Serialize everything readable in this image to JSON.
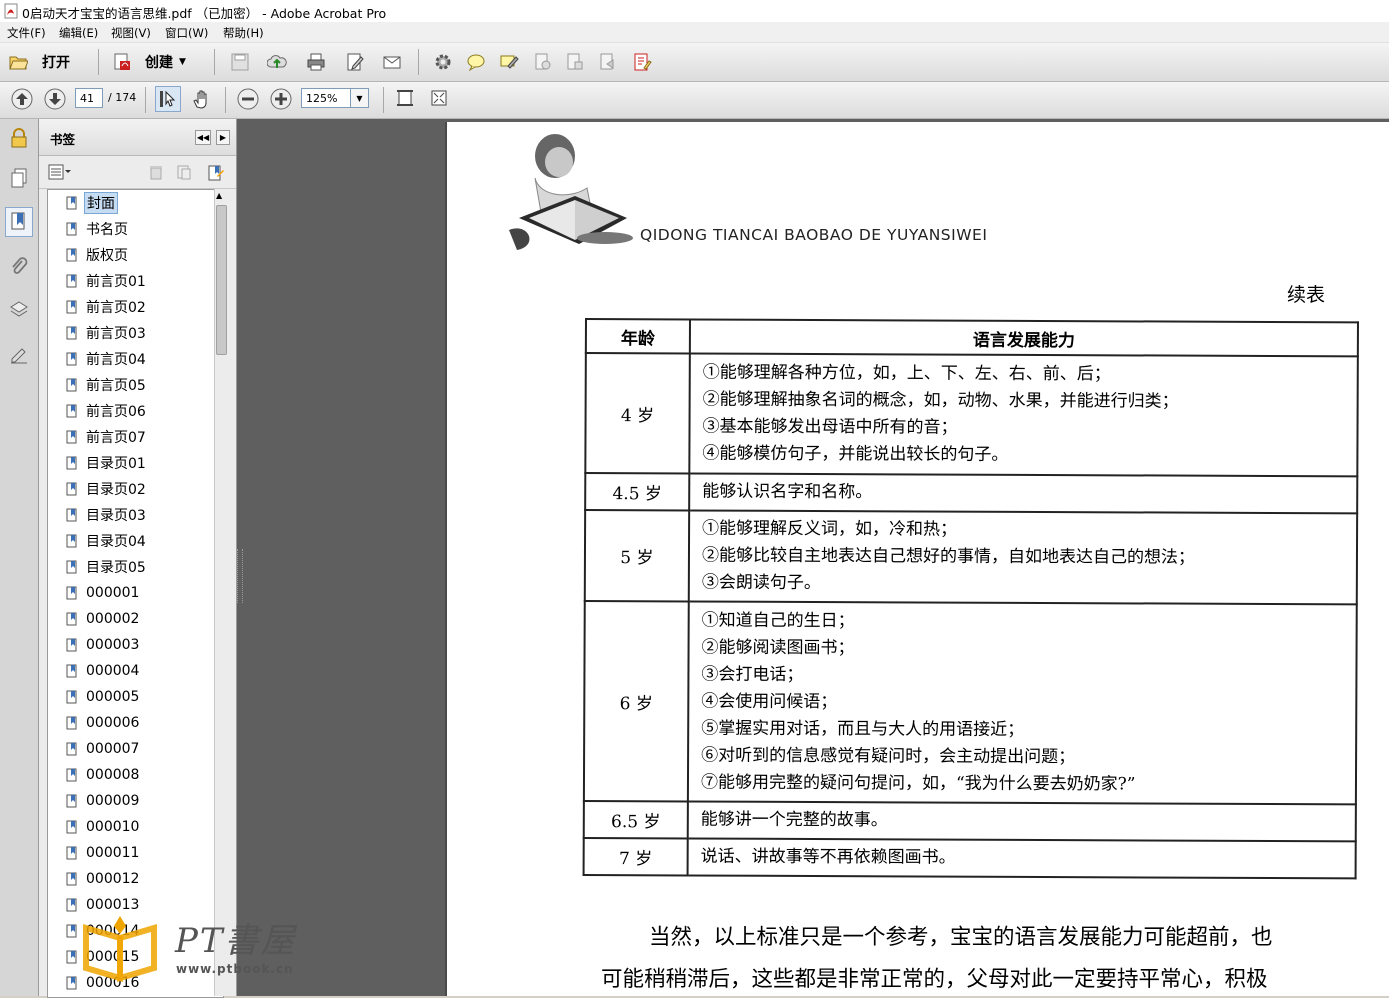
{
  "window": {
    "title": "0启动天才宝宝的语言思维.pdf （已加密） - Adobe Acrobat Pro"
  },
  "menu": [
    "文件(F)",
    "编辑(E)",
    "视图(V)",
    "窗口(W)",
    "帮助(H)"
  ],
  "toolbar": {
    "open_label": "打开",
    "create_label": "创建"
  },
  "nav": {
    "page_number": "41",
    "page_total": "/ 174",
    "zoom": "125%"
  },
  "bookmarks": {
    "title": "书签",
    "items": [
      "封面",
      "书名页",
      "版权页",
      "前言页01",
      "前言页02",
      "前言页03",
      "前言页04",
      "前言页05",
      "前言页06",
      "前言页07",
      "目录页01",
      "目录页02",
      "目录页03",
      "目录页04",
      "目录页05",
      "000001",
      "000002",
      "000003",
      "000004",
      "000005",
      "000006",
      "000007",
      "000008",
      "000009",
      "000010",
      "000011",
      "000012",
      "000013",
      "000014",
      "000015",
      "000016"
    ],
    "selected": "封面"
  },
  "document": {
    "header_text": "QIDONG TIANCAI BAOBAO DE YUYANSIWEI",
    "continued": "续表",
    "table": {
      "headers": [
        "年龄",
        "语言发展能力"
      ],
      "rows": [
        {
          "age": "4 岁",
          "lines": [
            "①能够理解各种方位，如，上、下、左、右、前、后；",
            "②能够理解抽象名词的概念，如，动物、水果，并能进行归类；",
            "③基本能够发出母语中所有的音；",
            "④能够模仿句子，并能说出较长的句子。"
          ]
        },
        {
          "age": "4.5 岁",
          "lines": [
            "能够认识名字和名称。"
          ]
        },
        {
          "age": "5 岁",
          "lines": [
            "①能够理解反义词，如，冷和热；",
            "②能够比较自主地表达自己想好的事情，自如地表达自己的想法；",
            "③会朗读句子。"
          ]
        },
        {
          "age": "6 岁",
          "lines": [
            "①知道自己的生日；",
            "②能够阅读图画书；",
            "③会打电话；",
            "④会使用问候语；",
            "⑤掌握实用对话，而且与大人的用语接近；",
            "⑥对听到的信息感觉有疑问时，会主动提出问题；",
            "⑦能够用完整的疑问句提问，如，“我为什么要去奶奶家?”"
          ]
        },
        {
          "age": "6.5 岁",
          "lines": [
            "能够讲一个完整的故事。"
          ]
        },
        {
          "age": "7 岁",
          "lines": [
            "说话、讲故事等不再依赖图画书。"
          ]
        }
      ]
    },
    "paragraph": [
      "当然，以上标准只是一个参考，宝宝的语言发展能力可能超前，也",
      "可能稍稍滞后，这些都是非常正常的，父母对此一定要持平常心，积极"
    ]
  },
  "watermark": {
    "text": "PT書屋",
    "url": "www.ptbook.cn"
  },
  "colors": {
    "accent": "#c5dcf3",
    "pdf_red": "#cc1f1f"
  }
}
